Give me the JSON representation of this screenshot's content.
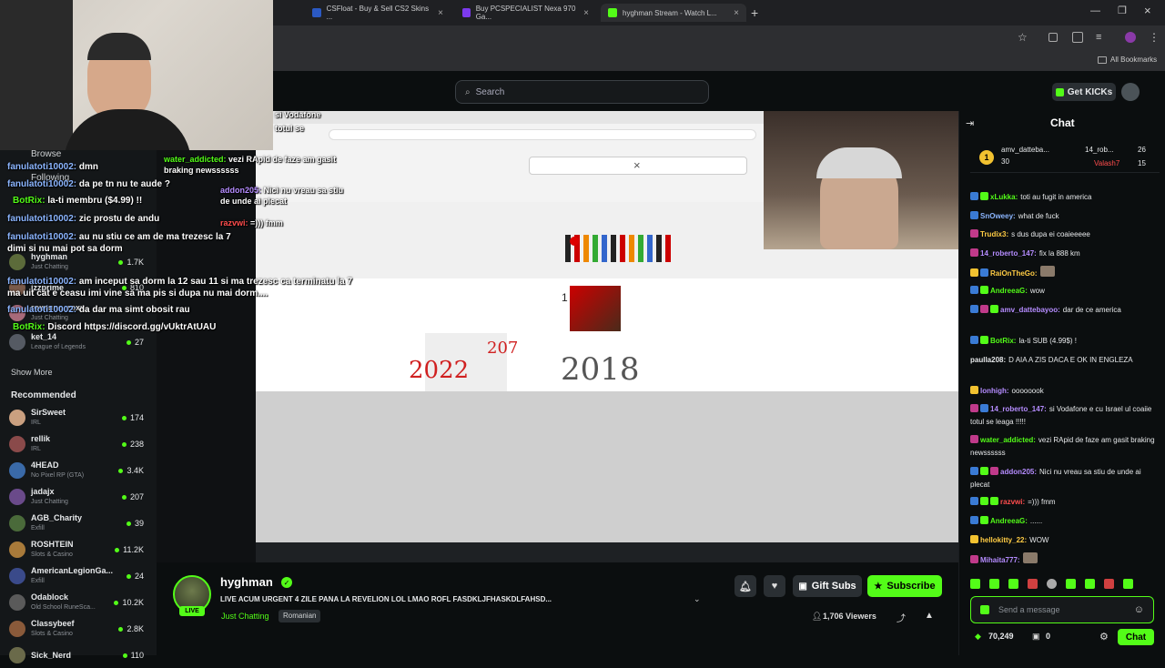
{
  "browser": {
    "tabs": [
      {
        "label": "CSFloat - Buy & Sell CS2 Skins ..."
      },
      {
        "label": "Buy PCSPECIALIST Nexa 970 Ga..."
      },
      {
        "label": "hyghman Stream - Watch L..."
      }
    ],
    "bookmarks_label": "All Bookmarks"
  },
  "header": {
    "search_placeholder": "Search",
    "get_kicks_label": "Get KICKs"
  },
  "sidebar": {
    "browse_label": "Browse",
    "following_label": "Following",
    "following_items": [
      {
        "name": "hyghman",
        "sub": "Just Chatting",
        "count": "1.7K"
      },
      {
        "name": "izzprime",
        "sub": "",
        "count": "810"
      },
      {
        "name": "roxanne_roxx",
        "sub": "Just Chatting",
        "count": ""
      },
      {
        "name": "ket_14",
        "sub": "League of Legends",
        "count": "27"
      }
    ],
    "show_more_label": "Show More",
    "recommended_label": "Recommended",
    "recommended_items": [
      {
        "name": "SirSweet",
        "sub": "IRL",
        "count": "174"
      },
      {
        "name": "rellik",
        "sub": "IRL",
        "count": "238"
      },
      {
        "name": "4HEAD",
        "sub": "No Pixel RP (GTA)",
        "count": "3.4K"
      },
      {
        "name": "jadajx",
        "sub": "Just Chatting",
        "count": "207"
      },
      {
        "name": "AGB_Charity",
        "sub": "Exfill",
        "count": "39"
      },
      {
        "name": "ROSHTEIN",
        "sub": "Slots & Casino",
        "count": "11.2K"
      },
      {
        "name": "AmericanLegionGa...",
        "sub": "Exfill",
        "count": "24"
      },
      {
        "name": "Odablock",
        "sub": "Old School RuneSca...",
        "count": "10.2K"
      },
      {
        "name": "Classybeef",
        "sub": "Slots & Casino",
        "count": "2.8K"
      },
      {
        "name": "Sick_Nerd",
        "sub": "",
        "count": "110"
      }
    ]
  },
  "overlay_chat": [
    {
      "user": "fanulatoti10002:",
      "text": "dmn"
    },
    {
      "user": "fanulatoti10002:",
      "text": "da pe tn nu te aude ?"
    },
    {
      "user": "BotRix:",
      "text": "la-ti membru ($4.99) !!"
    },
    {
      "user": "fanulatoti10002:",
      "text": "zic prostu de andu"
    },
    {
      "user": "fanulatoti10002:",
      "text": "au nu stiu ce am de ma trezesc la 7 dimi si nu mai pot sa dorm"
    },
    {
      "user": "fanulatoti10002:",
      "text": "am inceput sa dorm la 12 sau 11 si ma trezesc ca terminatu la 7 ma uit cat e ceasu imi vine sa ma pis si dupa nu mai dorm...."
    },
    {
      "user": "fanulatoti10002:",
      "text": "da dar ma simt obosit rau"
    },
    {
      "user": "BotRix:",
      "text": "Discord https://discord.gg/vUktrAtUAU"
    }
  ],
  "stream_overlay": {
    "alert_user": "water_addicted:",
    "alert_text": "vezi RApid de faze am gasit braking newssssss",
    "alert2_user": "addon205:",
    "alert2_text": "Nici nu vreau sa stiu de unde ai plecat",
    "alert3_user": "razvwi:",
    "alert3_text": "=))) fmm",
    "vodafone_text": "si Vodafone",
    "totul_text": "totul se",
    "drawing_year1": "2022",
    "drawing_year2": "2018",
    "drawing_red": "207",
    "drawing_one": "1"
  },
  "channel": {
    "name": "hyghman",
    "live_label": "LIVE",
    "title": "LIVE ACUM URGENT 4 ZILE PANA LA REVELION LOL LMAO ROFL FASDKLJFHASKDLFAHSD...",
    "category": "Just Chatting",
    "language": "Romanian",
    "viewers": "1,706 Viewers",
    "gift_subs_label": "Gift Subs",
    "subscribe_label": "Subscribe"
  },
  "chat": {
    "title": "Chat",
    "pinned": [
      {
        "user": "amv_datteba...",
        "value": "30"
      },
      {
        "user": "14_rob...",
        "value": "26"
      },
      {
        "user": "Valash7",
        "value": "15"
      }
    ],
    "messages": [
      {
        "user": "xLukka:",
        "text": "toti au fugit in america",
        "color": "#53fc18"
      },
      {
        "user": "SnOweey:",
        "text": "what de fuck",
        "color": "#8bb5ff"
      },
      {
        "user": "Trudix3:",
        "text": "s dus dupa ei coaieeeee",
        "color": "#ffcc44"
      },
      {
        "user": "14_roberto_147:",
        "text": "fix la 888 km",
        "color": "#b58cff"
      },
      {
        "user": "RaiOnTheGo:",
        "text": "",
        "color": "#ffcc44"
      },
      {
        "user": "AndreeaG:",
        "text": "wow",
        "color": "#53fc18"
      },
      {
        "user": "amv_dattebayoo:",
        "text": "dar de ce america",
        "color": "#b58cff"
      },
      {
        "user": "BotRix:",
        "text": "la-ti SUB (4.99$) !",
        "color": "#53fc18"
      },
      {
        "user": "paulla208:",
        "text": "D AIA A ZIS DACA E OK IN ENGLEZA",
        "color": "#e6e8ea"
      },
      {
        "user": "lonhigh:",
        "text": "oooooook",
        "color": "#b58cff"
      },
      {
        "user": "14_roberto_147:",
        "text": "si Vodafone e cu Israel ul coaiie totul se leaga !!!!!",
        "color": "#b58cff"
      },
      {
        "user": "water_addicted:",
        "text": "vezi RApid de faze am gasit braking newssssss",
        "color": "#53fc18"
      },
      {
        "user": "addon205:",
        "text": "Nici nu vreau sa stiu de unde ai plecat",
        "color": "#b58cff"
      },
      {
        "user": "razvwi:",
        "text": "=))) fmm",
        "color": "#ff4d4d"
      },
      {
        "user": "AndreeaG:",
        "text": "......",
        "color": "#53fc18"
      },
      {
        "user": "hellokitty_22:",
        "text": "WOW",
        "color": "#ffcc44"
      },
      {
        "user": "Mihaita777:",
        "text": "",
        "color": "#b58cff"
      }
    ],
    "input_placeholder": "Send a message",
    "points": "70,249",
    "gift_count": "0",
    "send_label": "Chat"
  },
  "colors": {
    "accent": "#53fc18",
    "background": "#0b0e0f",
    "sidebar": "#141719"
  }
}
